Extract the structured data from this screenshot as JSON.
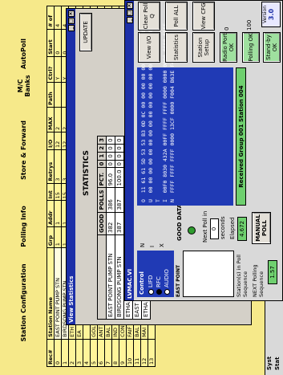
{
  "config": {
    "headers": {
      "station_configuration": "Station Configuration",
      "polling_info": "Polling Info",
      "store_forward": "Store & Forward",
      "mc_banks": "M/C Banks",
      "autopoll": "AutoPoll"
    },
    "columns": [
      "Rec#",
      "Station Name",
      "Grp",
      "Addr",
      "Int",
      "Retrys",
      "I/O",
      "MAX",
      "Path",
      "Ctrl?",
      "Start",
      "# of"
    ],
    "rows": [
      [
        "0",
        "EAST POINT PUMP STN",
        "1",
        "1",
        "15",
        "3",
        "12",
        "2",
        "",
        "Y",
        "0",
        "4"
      ],
      [
        "1",
        "BIRDSONG PUMP STN",
        "1",
        "1",
        "15",
        "3",
        "12",
        "2",
        "",
        "Y",
        "0",
        "4"
      ],
      [
        "2",
        "ETH",
        "",
        "",
        "",
        "",
        "",
        "",
        "",
        "",
        "",
        ""
      ],
      [
        "3",
        "EA",
        "",
        "",
        "",
        "",
        "",
        "",
        "",
        "",
        "",
        ""
      ],
      [
        "4",
        "",
        "",
        "",
        "",
        "",
        "",
        "",
        "",
        "",
        "",
        ""
      ],
      [
        "5",
        "GOL",
        "",
        "",
        "",
        "",
        "",
        "",
        "",
        "",
        "",
        ""
      ],
      [
        "6",
        "ANT",
        "",
        "",
        "",
        "",
        "",
        "",
        "",
        "",
        "",
        ""
      ],
      [
        "7",
        "BAL",
        "",
        "",
        "",
        "",
        "",
        "",
        "",
        "",
        "",
        ""
      ],
      [
        "8",
        "IND",
        "",
        "",
        "",
        "",
        "",
        "",
        "",
        "",
        "",
        ""
      ],
      [
        "9",
        "CON",
        "",
        "",
        "",
        "",
        "",
        "",
        "",
        "",
        "",
        ""
      ],
      [
        "10",
        "FAIF",
        "",
        "",
        "",
        "",
        "",
        "",
        "",
        "",
        "",
        ""
      ],
      [
        "11",
        "BAL",
        "",
        "",
        "",
        "",
        "",
        "",
        "",
        "",
        "",
        ""
      ],
      [
        "12",
        "MAI",
        "",
        "",
        "",
        "",
        "",
        "",
        "",
        "",
        "",
        ""
      ],
      [
        "13",
        "",
        "",
        "",
        "",
        "",
        "",
        "",
        "",
        "",
        "",
        ""
      ]
    ],
    "sys_labels": [
      "Syst",
      "Stat"
    ]
  },
  "stats": {
    "title": "View Statistics",
    "heading": "STATISTICS",
    "columns": [
      "GOOD",
      "POLLS",
      "PCT.",
      "0",
      "1",
      "2",
      "3"
    ],
    "rows": [
      [
        "EAST POINT PUMP STN",
        "382",
        "386",
        "96.0",
        "0",
        "0",
        "0",
        "0"
      ],
      [
        "BIRDSONG PUMP STN",
        "387",
        "387",
        "100.0",
        "0",
        "0",
        "0",
        "0"
      ],
      [
        "ETHA PUMP STN",
        "380",
        "404",
        "94.1",
        "0",
        "0",
        "0",
        "0"
      ],
      [
        "EAST POINT METER",
        "377",
        "403",
        "93.5",
        "0",
        "0",
        "0",
        "0"
      ],
      [
        "ETHA METER",
        "383",
        "383",
        "100.0",
        "0",
        "0",
        "0",
        "0"
      ]
    ],
    "update_label": "UPDATE"
  },
  "lvmac": {
    "title": "LVMAC.VI",
    "control_label": "Control",
    "comm_labels": [
      "N",
      "I",
      "X"
    ],
    "options": [
      "LIFD",
      "RFC",
      "AUDIO"
    ],
    "east_point_label": "EAST POINT",
    "next_poll_label": "Next Poll in",
    "next_poll_value": "0",
    "seconds_label": "seconds",
    "elapsed_label": "Elapsed",
    "elapsed_value": "4.672",
    "good_data_label": "GOOD DATA?",
    "manual_poll_label": "MANUAL POLL",
    "station_list_label": "Station(s) in Poll Sequence",
    "next_seq_label": "NEXT Polling Sequence",
    "next_seq_value": "1.57",
    "terminal_lines": [
      "O  11 61 61 5D 53 53 B3 0D 0C 00 00 00 00 00 00 00 00 00 00 00",
      "U  00 00 00 00 00 00 00 00 00 00 00 00 00 00 00 F0 00 04 A5 A6",
      "T",
      "",
      "I  00F0 8030 432A 00FF FFFF FFFF 0000 0000 0000 0000 FFFF",
      "N  FFFF FFFF FFFF 0000 13CF 0000 F004 B63E F4"
    ],
    "received_text": "Received Group 001 Station 004",
    "buttons": {
      "view_io": "View I/O",
      "clear_poll_q": "Clear Poll Q",
      "statistics": "Statistics",
      "poll_all": "Poll ALL",
      "station_setup": "Station Setup",
      "view_cfg": "View CFG",
      "radio_port": "Radio Port OK",
      "polling": "Polling OK",
      "standby": "Stand-by OK",
      "port_number": "0",
      "timer_value": "100"
    },
    "version_label": "Version",
    "version_value": "3.0"
  },
  "colors": {
    "title_bar": "#1c2fa8",
    "config_bg": "#f6e98a",
    "blue_panel": "#203ab5",
    "status_green": "#6fd06f"
  }
}
